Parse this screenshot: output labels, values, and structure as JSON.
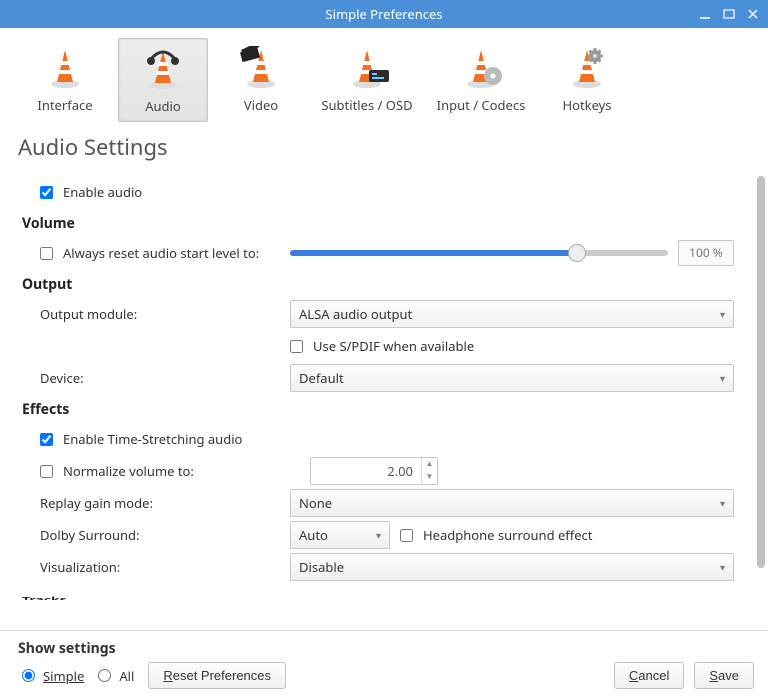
{
  "window": {
    "title": "Simple Preferences"
  },
  "tabs": {
    "interface": "Interface",
    "audio": "Audio",
    "video": "Video",
    "subtitles": "Subtitles / OSD",
    "input_codecs": "Input / Codecs",
    "hotkeys": "Hotkeys"
  },
  "page_title": "Audio Settings",
  "enable_audio": {
    "label": "Enable audio",
    "checked": true
  },
  "volume": {
    "title": "Volume",
    "always_reset_label": "Always reset audio start level to:",
    "always_reset_checked": false,
    "percent_text": "100 %",
    "slider_percent": 76
  },
  "output": {
    "title": "Output",
    "module_label": "Output module:",
    "module_value": "ALSA audio output",
    "spdif_label": "Use S/PDIF when available",
    "spdif_checked": false,
    "device_label": "Device:",
    "device_value": "Default"
  },
  "effects": {
    "title": "Effects",
    "timestretch_label": "Enable Time-Stretching audio",
    "timestretch_checked": true,
    "normalize_label": "Normalize volume to:",
    "normalize_checked": false,
    "normalize_value": "2.00",
    "replay_label": "Replay gain mode:",
    "replay_value": "None",
    "dolby_label": "Dolby Surround:",
    "dolby_value": "Auto",
    "headphone_label": "Headphone surround effect",
    "headphone_checked": false,
    "viz_label": "Visualization:",
    "viz_value": "Disable"
  },
  "tracks_title": "Tracks",
  "bottom": {
    "show_settings": "Show settings",
    "simple": "Simple",
    "all": "All",
    "reset": "Reset Preferences",
    "cancel": "Cancel",
    "save_prefix": "S",
    "save_rest": "ave"
  }
}
